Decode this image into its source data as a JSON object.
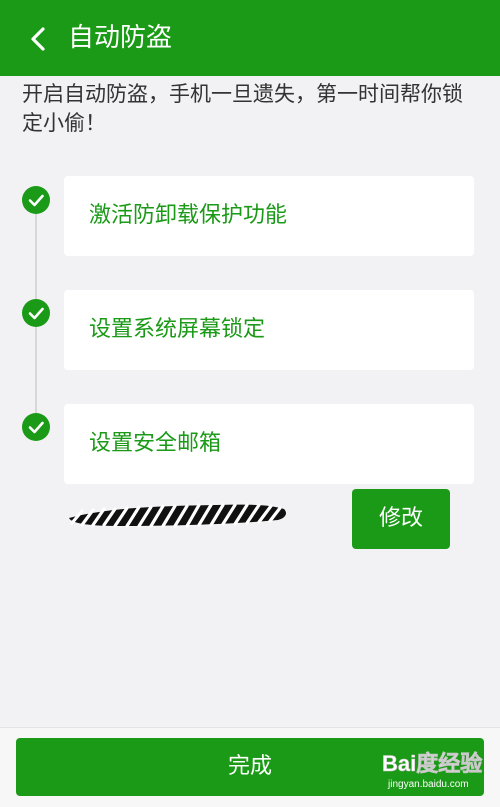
{
  "header": {
    "title": "自动防盗"
  },
  "intro_text": "开启自动防盗，手机一旦遗失，第一时间帮你锁定小偷！",
  "steps": [
    {
      "label": "激活防卸载保护功能",
      "status": "completed"
    },
    {
      "label": "设置系统屏幕锁定",
      "status": "completed"
    },
    {
      "label": "设置安全邮箱",
      "status": "completed"
    }
  ],
  "email": {
    "edit_label": "修改"
  },
  "footer": {
    "done_label": "完成"
  },
  "watermark": {
    "logo": "Bai度经验",
    "url": "jingyan.baidu.com"
  },
  "colors": {
    "brand_green": "#1a9a16",
    "background": "#f2f1f4",
    "card": "#ffffff"
  },
  "icons": {
    "back": "chevron-left-icon",
    "step_done": "checkmark-icon"
  }
}
